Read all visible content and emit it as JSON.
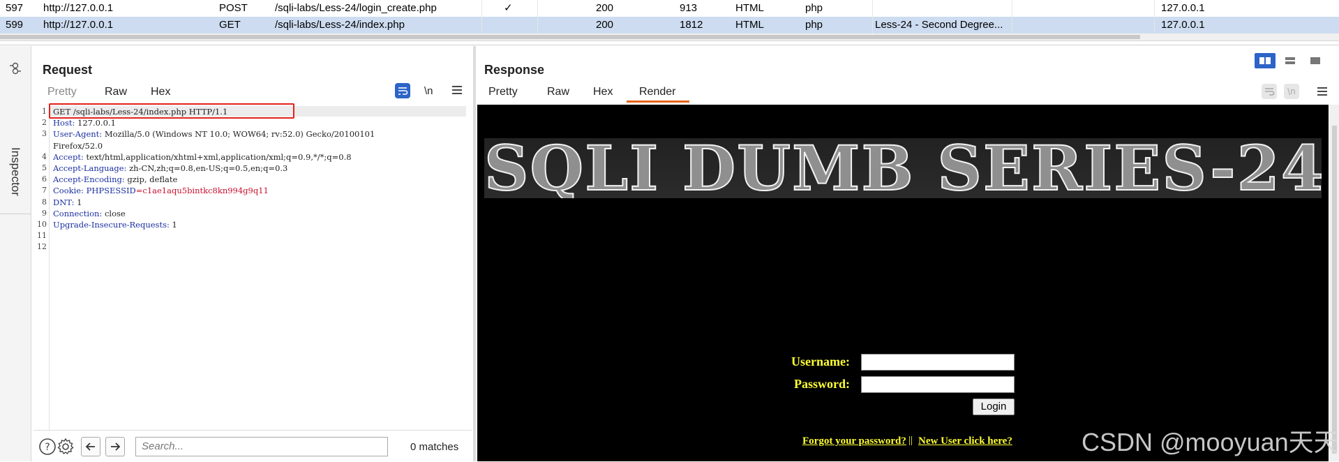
{
  "history": {
    "rows": [
      {
        "num": "597",
        "host": "http://127.0.0.1",
        "method": "POST",
        "url": "/sqli-labs/Less-24/login_create.php",
        "params": "✓",
        "status": "200",
        "length": "913",
        "mime": "HTML",
        "ext": "php",
        "title": "",
        "ip": "127.0.0.1"
      },
      {
        "num": "599",
        "host": "http://127.0.0.1",
        "method": "GET",
        "url": "/sqli-labs/Less-24/index.php",
        "params": "",
        "status": "200",
        "length": "1812",
        "mime": "HTML",
        "ext": "php",
        "title": "Less-24 - Second Degree...",
        "ip": "127.0.0.1"
      }
    ]
  },
  "inspector": {
    "label": "Inspector"
  },
  "request": {
    "title": "Request",
    "tabs": [
      "Pretty",
      "Raw",
      "Hex"
    ],
    "newline_label": "\\n",
    "lines": [
      {
        "n": "1",
        "key": "GET /sqli-labs/Less-24/index.php HTTP/1.1",
        "val": ""
      },
      {
        "n": "2",
        "key": "Host:",
        "val": " 127.0.0.1"
      },
      {
        "n": "3",
        "key": "User-Agent:",
        "val": " Mozilla/5.0 (Windows NT 10.0; WOW64; rv:52.0) Gecko/20100101"
      },
      {
        "n": "",
        "key": "",
        "val": "Firefox/52.0"
      },
      {
        "n": "4",
        "key": "Accept:",
        "val": " text/html,application/xhtml+xml,application/xml;q=0.9,*/*;q=0.8"
      },
      {
        "n": "5",
        "key": "Accept-Language:",
        "val": " zh-CN,zh;q=0.8,en-US;q=0.5,en;q=0.3"
      },
      {
        "n": "6",
        "key": "Accept-Encoding:",
        "val": " gzip, deflate"
      },
      {
        "n": "7",
        "key": "Cookie:",
        "val": " PHPSESSID=c1ae1aqu5bintkc8kn994g9q11"
      },
      {
        "n": "8",
        "key": "DNT:",
        "val": " 1"
      },
      {
        "n": "9",
        "key": "Connection:",
        "val": " close"
      },
      {
        "n": "10",
        "key": "Upgrade-Insecure-Requests:",
        "val": " 1"
      },
      {
        "n": "11",
        "key": "",
        "val": ""
      },
      {
        "n": "12",
        "key": "",
        "val": ""
      }
    ],
    "cookie_name": "PHPSESSID",
    "cookie_value": "=c1ae1aqu5bintkc8kn994g9q11",
    "search_placeholder": "Search...",
    "matches": "0 matches"
  },
  "response": {
    "title": "Response",
    "tabs": [
      "Pretty",
      "Raw",
      "Hex",
      "Render"
    ],
    "active_tab": "Render",
    "render": {
      "banner": "SQLI DUMB SERIES-24",
      "username_label": "Username:",
      "password_label": "Password:",
      "login_button": "Login",
      "forgot_link": "Forgot your password?",
      "separator": "||",
      "new_user_link": "New User click here?"
    }
  },
  "watermark": "CSDN @mooyuan天天",
  "colors": {
    "selected_row": "#cddcf0",
    "accent": "#e8641b",
    "highlight_box": "#e3211b",
    "render_label": "#ffff33",
    "header_key": "#1b2fa0"
  }
}
